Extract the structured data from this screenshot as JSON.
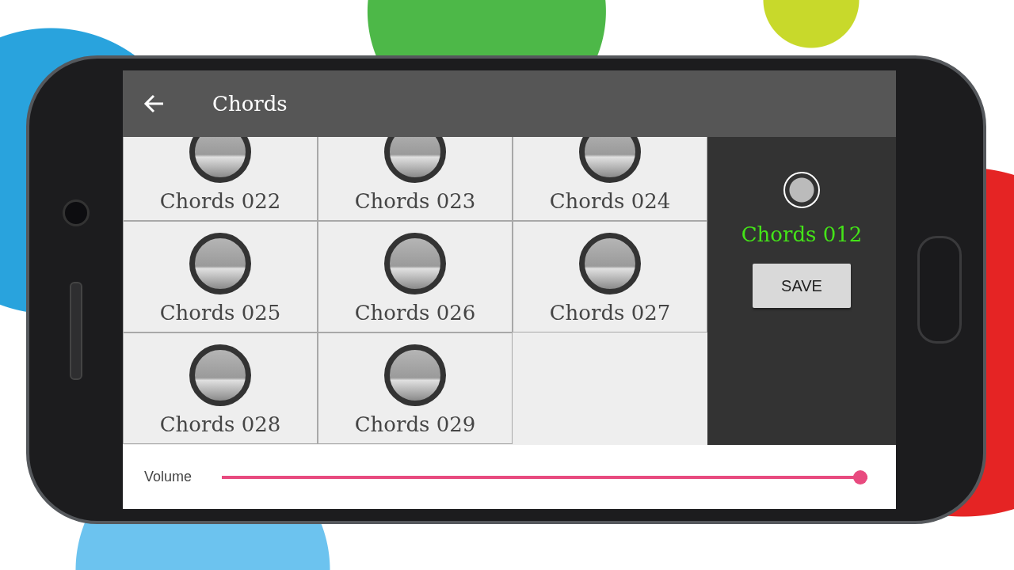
{
  "app_bar": {
    "title": "Chords"
  },
  "pads": [
    {
      "label": "Chords 022"
    },
    {
      "label": "Chords 023"
    },
    {
      "label": "Chords 024"
    },
    {
      "label": "Chords 025"
    },
    {
      "label": "Chords 026"
    },
    {
      "label": "Chords 027"
    },
    {
      "label": "Chords 028"
    },
    {
      "label": "Chords 029"
    }
  ],
  "side_panel": {
    "current": "Chords 012",
    "button": "SAVE"
  },
  "volume": {
    "label": "Volume",
    "level": 1
  }
}
